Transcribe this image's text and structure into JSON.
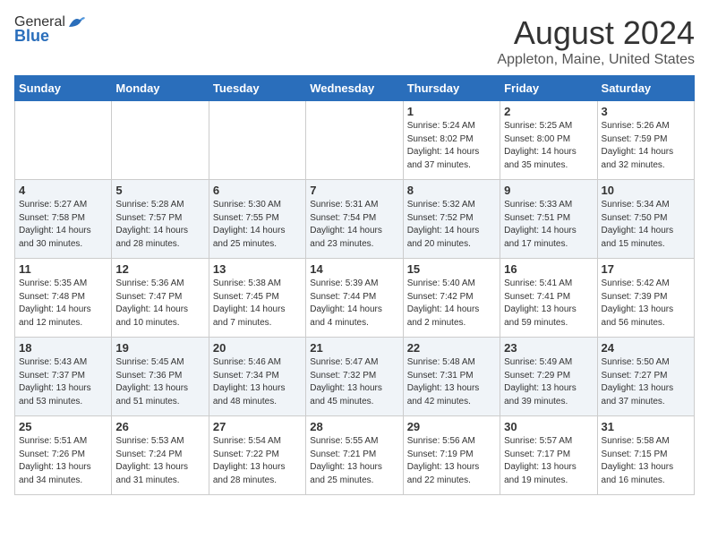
{
  "logo": {
    "general": "General",
    "blue": "Blue"
  },
  "title": "August 2024",
  "subtitle": "Appleton, Maine, United States",
  "headers": [
    "Sunday",
    "Monday",
    "Tuesday",
    "Wednesday",
    "Thursday",
    "Friday",
    "Saturday"
  ],
  "weeks": [
    [
      {
        "day": "",
        "info": ""
      },
      {
        "day": "",
        "info": ""
      },
      {
        "day": "",
        "info": ""
      },
      {
        "day": "",
        "info": ""
      },
      {
        "day": "1",
        "info": "Sunrise: 5:24 AM\nSunset: 8:02 PM\nDaylight: 14 hours\nand 37 minutes."
      },
      {
        "day": "2",
        "info": "Sunrise: 5:25 AM\nSunset: 8:00 PM\nDaylight: 14 hours\nand 35 minutes."
      },
      {
        "day": "3",
        "info": "Sunrise: 5:26 AM\nSunset: 7:59 PM\nDaylight: 14 hours\nand 32 minutes."
      }
    ],
    [
      {
        "day": "4",
        "info": "Sunrise: 5:27 AM\nSunset: 7:58 PM\nDaylight: 14 hours\nand 30 minutes."
      },
      {
        "day": "5",
        "info": "Sunrise: 5:28 AM\nSunset: 7:57 PM\nDaylight: 14 hours\nand 28 minutes."
      },
      {
        "day": "6",
        "info": "Sunrise: 5:30 AM\nSunset: 7:55 PM\nDaylight: 14 hours\nand 25 minutes."
      },
      {
        "day": "7",
        "info": "Sunrise: 5:31 AM\nSunset: 7:54 PM\nDaylight: 14 hours\nand 23 minutes."
      },
      {
        "day": "8",
        "info": "Sunrise: 5:32 AM\nSunset: 7:52 PM\nDaylight: 14 hours\nand 20 minutes."
      },
      {
        "day": "9",
        "info": "Sunrise: 5:33 AM\nSunset: 7:51 PM\nDaylight: 14 hours\nand 17 minutes."
      },
      {
        "day": "10",
        "info": "Sunrise: 5:34 AM\nSunset: 7:50 PM\nDaylight: 14 hours\nand 15 minutes."
      }
    ],
    [
      {
        "day": "11",
        "info": "Sunrise: 5:35 AM\nSunset: 7:48 PM\nDaylight: 14 hours\nand 12 minutes."
      },
      {
        "day": "12",
        "info": "Sunrise: 5:36 AM\nSunset: 7:47 PM\nDaylight: 14 hours\nand 10 minutes."
      },
      {
        "day": "13",
        "info": "Sunrise: 5:38 AM\nSunset: 7:45 PM\nDaylight: 14 hours\nand 7 minutes."
      },
      {
        "day": "14",
        "info": "Sunrise: 5:39 AM\nSunset: 7:44 PM\nDaylight: 14 hours\nand 4 minutes."
      },
      {
        "day": "15",
        "info": "Sunrise: 5:40 AM\nSunset: 7:42 PM\nDaylight: 14 hours\nand 2 minutes."
      },
      {
        "day": "16",
        "info": "Sunrise: 5:41 AM\nSunset: 7:41 PM\nDaylight: 13 hours\nand 59 minutes."
      },
      {
        "day": "17",
        "info": "Sunrise: 5:42 AM\nSunset: 7:39 PM\nDaylight: 13 hours\nand 56 minutes."
      }
    ],
    [
      {
        "day": "18",
        "info": "Sunrise: 5:43 AM\nSunset: 7:37 PM\nDaylight: 13 hours\nand 53 minutes."
      },
      {
        "day": "19",
        "info": "Sunrise: 5:45 AM\nSunset: 7:36 PM\nDaylight: 13 hours\nand 51 minutes."
      },
      {
        "day": "20",
        "info": "Sunrise: 5:46 AM\nSunset: 7:34 PM\nDaylight: 13 hours\nand 48 minutes."
      },
      {
        "day": "21",
        "info": "Sunrise: 5:47 AM\nSunset: 7:32 PM\nDaylight: 13 hours\nand 45 minutes."
      },
      {
        "day": "22",
        "info": "Sunrise: 5:48 AM\nSunset: 7:31 PM\nDaylight: 13 hours\nand 42 minutes."
      },
      {
        "day": "23",
        "info": "Sunrise: 5:49 AM\nSunset: 7:29 PM\nDaylight: 13 hours\nand 39 minutes."
      },
      {
        "day": "24",
        "info": "Sunrise: 5:50 AM\nSunset: 7:27 PM\nDaylight: 13 hours\nand 37 minutes."
      }
    ],
    [
      {
        "day": "25",
        "info": "Sunrise: 5:51 AM\nSunset: 7:26 PM\nDaylight: 13 hours\nand 34 minutes."
      },
      {
        "day": "26",
        "info": "Sunrise: 5:53 AM\nSunset: 7:24 PM\nDaylight: 13 hours\nand 31 minutes."
      },
      {
        "day": "27",
        "info": "Sunrise: 5:54 AM\nSunset: 7:22 PM\nDaylight: 13 hours\nand 28 minutes."
      },
      {
        "day": "28",
        "info": "Sunrise: 5:55 AM\nSunset: 7:21 PM\nDaylight: 13 hours\nand 25 minutes."
      },
      {
        "day": "29",
        "info": "Sunrise: 5:56 AM\nSunset: 7:19 PM\nDaylight: 13 hours\nand 22 minutes."
      },
      {
        "day": "30",
        "info": "Sunrise: 5:57 AM\nSunset: 7:17 PM\nDaylight: 13 hours\nand 19 minutes."
      },
      {
        "day": "31",
        "info": "Sunrise: 5:58 AM\nSunset: 7:15 PM\nDaylight: 13 hours\nand 16 minutes."
      }
    ]
  ]
}
